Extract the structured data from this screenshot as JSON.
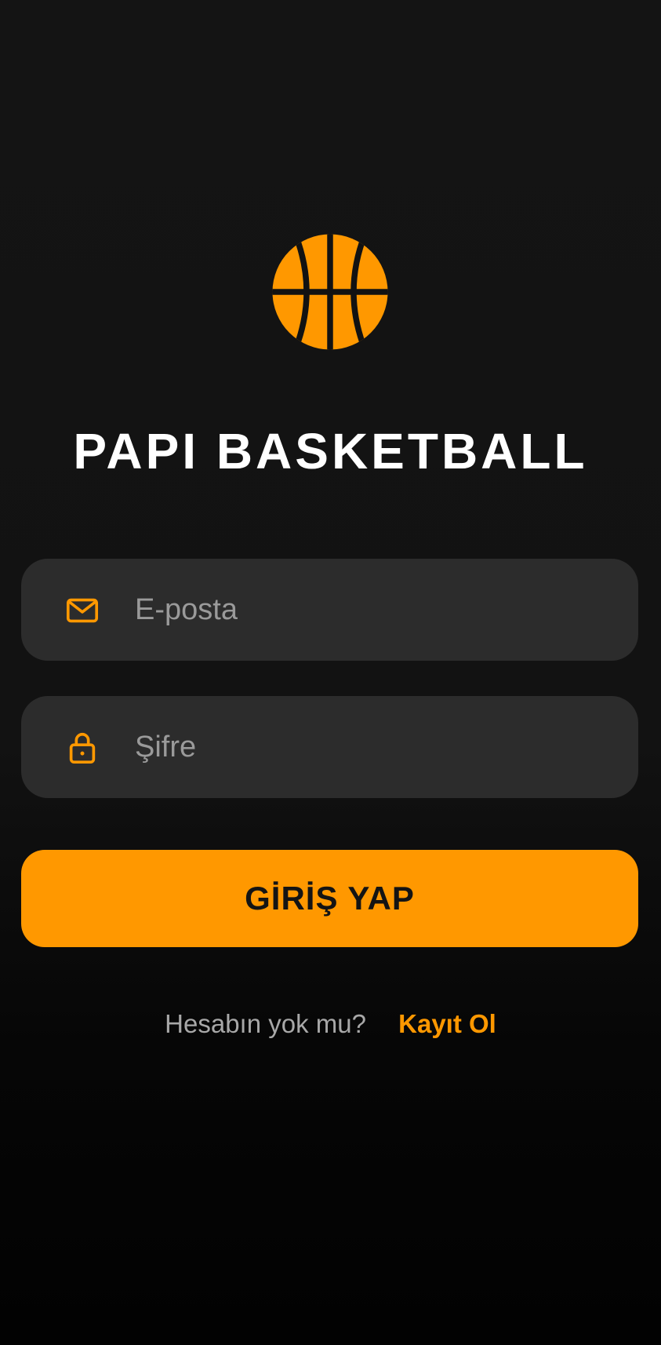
{
  "app": {
    "title": "PAPI BASKETBALL",
    "logo_icon": "basketball-icon"
  },
  "login_form": {
    "email": {
      "icon": "mail-icon",
      "placeholder": "E-posta",
      "value": ""
    },
    "password": {
      "icon": "lock-icon",
      "placeholder": "Şifre",
      "value": ""
    },
    "submit_label": "GİRİŞ YAP"
  },
  "register": {
    "prompt": "Hesabın yok mu?",
    "link_label": "Kayıt Ol"
  },
  "colors": {
    "accent": "#ff9800",
    "background": "#121212",
    "field_background": "#2c2c2c",
    "title_text": "#ffffff",
    "placeholder_text": "#9a9a9a"
  }
}
